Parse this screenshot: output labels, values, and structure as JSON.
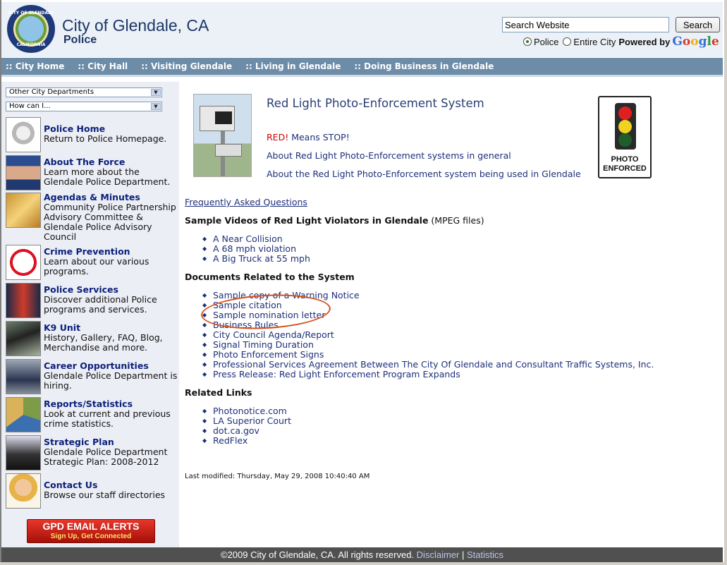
{
  "header": {
    "seal_top": "CITY OF GLENDALE",
    "seal_bottom": "CALIFORNIA",
    "title": "City of Glendale, CA",
    "subtitle": "Police",
    "search_value": "Search Website",
    "search_button": "Search",
    "scope_police": "Police",
    "scope_city": "Entire City",
    "powered_by": "Powered by",
    "google": "Google"
  },
  "nav": [
    ":: City Home",
    ":: City Hall",
    ":: Visiting Glendale",
    ":: Living in Glendale",
    ":: Doing Business in Glendale"
  ],
  "sidebar": {
    "select_departments": "Other City Departments",
    "select_howcan": "How can I...",
    "items": [
      {
        "title": "Police Home",
        "desc": "Return to Police Homepage.",
        "icon": "badge-icon"
      },
      {
        "title": "About The Force",
        "desc": "Learn more about the Glendale Police Department.",
        "icon": "chief-photo-icon"
      },
      {
        "title": "Agendas & Minutes",
        "desc": "Community Police Partnership Advisory Committee & Glendale Police Advisory Council",
        "icon": "agenda-icon"
      },
      {
        "title": "Crime Prevention",
        "desc": "Learn about our various programs.",
        "icon": "no-burglar-icon"
      },
      {
        "title": "Police Services",
        "desc": "Discover additional Police programs and services.",
        "icon": "services-icon"
      },
      {
        "title": "K9 Unit",
        "desc": "History, Gallery, FAQ, Blog, Merchandise and more.",
        "icon": "k9-icon"
      },
      {
        "title": "Career Opportunities",
        "desc": "Glendale Police Department is hiring.",
        "icon": "career-icon"
      },
      {
        "title": "Reports/Statistics",
        "desc": "Look at current and previous crime statistics.",
        "icon": "pie-chart-icon"
      },
      {
        "title": "Strategic Plan",
        "desc": "Glendale Police Department Strategic Plan: 2008-2012",
        "icon": "chess-icon"
      },
      {
        "title": "Contact Us",
        "desc": "Browse our staff directories",
        "icon": "operator-icon"
      }
    ],
    "alerts_title": "GPD EMAIL ALERTS",
    "alerts_sub": "Sign Up, Get Connected"
  },
  "main": {
    "title": "Red Light Photo-Enforcement System",
    "red_word": "RED!",
    "means_stop": " Means STOP!",
    "about_general": "About Red Light Photo-Enforcement systems in general",
    "about_glendale": "About the Red Light Photo-Enforcement system being used in Glendale",
    "sign_line1": "PHOTO",
    "sign_line2": "ENFORCED",
    "faq": "Frequently Asked Questions",
    "videos_heading": "Sample Videos of Red Light Violators in Glendale",
    "videos_note": " (MPEG files)",
    "videos": [
      "A Near Collision",
      "A 68 mph violation",
      "A Big Truck at 55 mph"
    ],
    "docs_heading": "Documents Related to the System",
    "docs": [
      "Sample copy of a Warning Notice",
      "Sample citation",
      "Sample nomination letter",
      "Business Rules",
      "City Council Agenda/Report",
      "Signal Timing Duration",
      "Photo Enforcement Signs",
      "Professional Services Agreement Between The City Of Glendale and Consultant Traffic Systems, Inc.",
      "Press Release: Red Light Enforcement Program Expands"
    ],
    "related_heading": "Related Links",
    "related": [
      "Photonotice.com",
      "LA Superior Court",
      "dot.ca.gov",
      "RedFlex"
    ],
    "modified": "Last modified: Thursday, May 29, 2008 10:40:40 AM"
  },
  "footer": {
    "copyright": "©2009 City of Glendale, CA. All rights reserved.",
    "disclaimer": "Disclaimer",
    "sep": "|",
    "statistics": "Statistics"
  },
  "colors": {
    "nav_bg": "#6c8ca8",
    "link": "#1d2f7a",
    "side_title": "#0a1f7a",
    "annotation_circle": "#d4501c",
    "footer_bg": "#505050"
  }
}
